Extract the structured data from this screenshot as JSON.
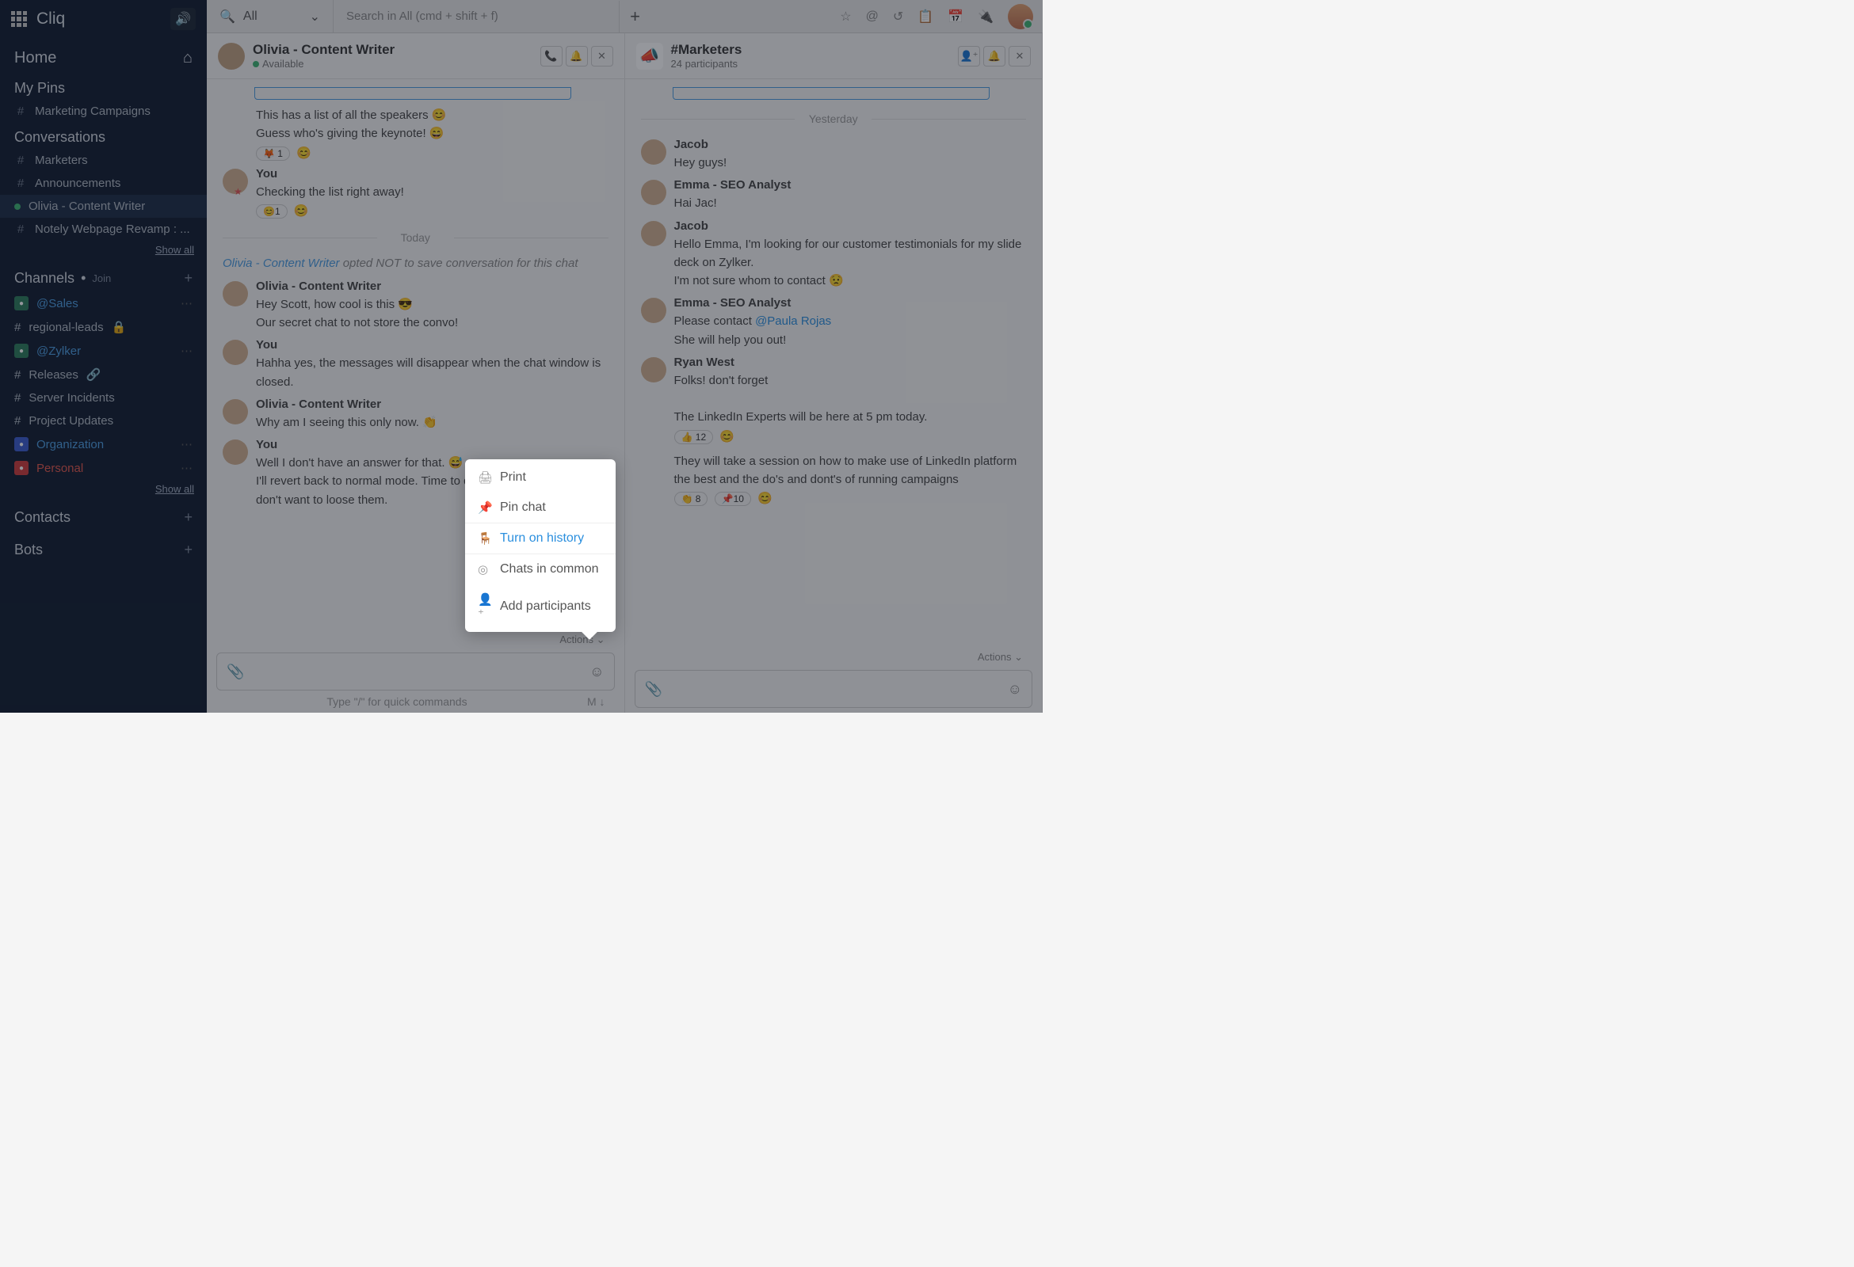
{
  "app": {
    "name": "Cliq"
  },
  "sidebar": {
    "home": "Home",
    "pins_header": "My Pins",
    "pins": [
      "Marketing Campaigns"
    ],
    "convos_header": "Conversations",
    "convos": [
      {
        "label": "Marketers",
        "kind": "hash"
      },
      {
        "label": "Announcements",
        "kind": "hash"
      },
      {
        "label": "Olivia - Content Writer",
        "kind": "dot"
      },
      {
        "label": "Notely Webpage Revamp : ...",
        "kind": "hash"
      }
    ],
    "show_all": "Show all",
    "channels_header": "Channels",
    "join_label": "Join",
    "channels": [
      {
        "label": "@Sales",
        "icon": "org",
        "color": "blue"
      },
      {
        "label": "regional-leads",
        "icon": "hash",
        "lock": true
      },
      {
        "label": "@Zylker",
        "icon": "org",
        "color": "blue"
      },
      {
        "label": "Releases",
        "icon": "hash",
        "link": true
      },
      {
        "label": "Server Incidents",
        "icon": "hash"
      },
      {
        "label": "Project Updates",
        "icon": "hash"
      },
      {
        "label": "Organization",
        "icon": "org2",
        "color": "blue"
      },
      {
        "label": "Personal",
        "icon": "pers",
        "color": "red"
      }
    ],
    "contacts_header": "Contacts",
    "bots_header": "Bots"
  },
  "topbar": {
    "filter": "All",
    "search_placeholder": "Search in All (cmd + shift + f)"
  },
  "left_pane": {
    "title": "Olivia - Content Writer",
    "status": "Available",
    "msgs": [
      {
        "type": "text",
        "sender": "",
        "lines": [
          "This has a list of all the speakers  😊",
          "Guess who's giving the keynote!   😄"
        ],
        "react": "🦊 1"
      },
      {
        "type": "you",
        "sender": "You",
        "star": true,
        "lines": [
          "Checking  the list right away!"
        ],
        "react": "😊1"
      },
      {
        "type": "div",
        "label": "Today"
      },
      {
        "type": "note",
        "who": "Olivia - Content Writer",
        "text": " opted NOT to save conversation for this chat"
      },
      {
        "type": "text",
        "sender": "Olivia - Content Writer",
        "lines": [
          "Hey Scott, how cool is this   😎",
          "Our secret chat to not store the convo!"
        ]
      },
      {
        "type": "you",
        "sender": "You",
        "lines": [
          "Hahha yes, the messages will disappear when the chat window is closed."
        ]
      },
      {
        "type": "text",
        "sender": "Olivia - Content Writer",
        "lines": [
          "Why am I seeing this only now.   👏"
        ]
      },
      {
        "type": "you",
        "sender": "You",
        "lines": [
          "Well I don't have an answer for that.   😅",
          "I'll revert back to normal mode. Time to discuss important things. I don't want to loose them."
        ]
      }
    ],
    "actions_label": "Actions",
    "hint": "Type \"/\" for quick commands",
    "md": "M ↓"
  },
  "right_pane": {
    "title": "#Marketers",
    "subtitle": "24 participants",
    "day": "Yesterday",
    "msgs": [
      {
        "sender": "Jacob",
        "lines": [
          "Hey guys!"
        ]
      },
      {
        "sender": "Emma - SEO Analyst",
        "lines": [
          "Hai Jac!"
        ]
      },
      {
        "sender": "Jacob",
        "lines": [
          "Hello Emma, I'm looking for our customer testimonials for my slide deck on Zylker.",
          "  I'm not sure whom to contact  😟"
        ]
      },
      {
        "sender": "Emma - SEO Analyst",
        "lines": [
          "Please contact "
        ],
        "mention": "@Paula Rojas",
        "after": " She will help you out!"
      },
      {
        "sender": "Ryan West",
        "lines": [
          "Folks! don't forget",
          "",
          "The LinkedIn Experts will be here at 5 pm today."
        ],
        "react1": "👍 12",
        "lines2": [
          "They will take a session on how to make use of LinkedIn platform the best and the do's and dont's of running campaigns"
        ],
        "react2a": "👏 8",
        "react2b": "📌10"
      }
    ],
    "actions_label": "Actions"
  },
  "popup": {
    "items": [
      {
        "label": "Print",
        "hl": false
      },
      {
        "label": "Pin chat",
        "hl": false
      },
      {
        "label": "Turn on history",
        "hl": true
      },
      {
        "label": "Chats in common",
        "hl": false
      },
      {
        "label": "Add participants",
        "hl": false
      }
    ]
  }
}
